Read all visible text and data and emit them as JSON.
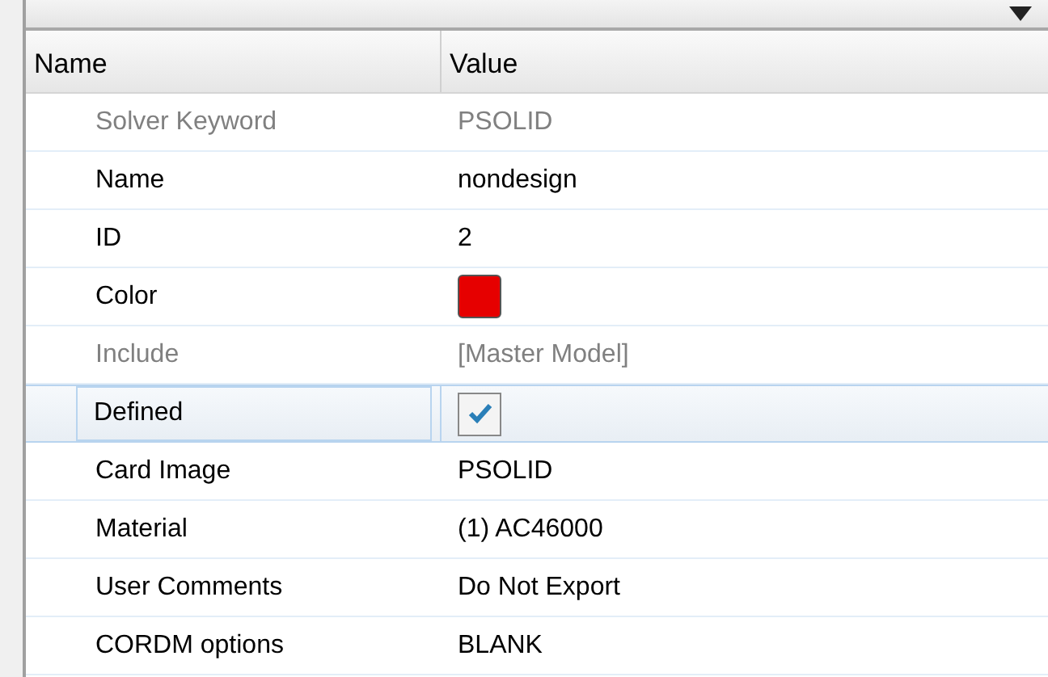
{
  "columns": [
    "Name",
    "Value"
  ],
  "rows": [
    {
      "name": "Solver Keyword",
      "kind": "text",
      "value": "PSOLID",
      "disabled": true,
      "selected": false
    },
    {
      "name": "Name",
      "kind": "text",
      "value": "nondesign",
      "disabled": false,
      "selected": false
    },
    {
      "name": "ID",
      "kind": "text",
      "value": "2",
      "disabled": false,
      "selected": false
    },
    {
      "name": "Color",
      "kind": "color",
      "color": "#e60000",
      "disabled": false,
      "selected": false
    },
    {
      "name": "Include",
      "kind": "text",
      "value": "[Master Model]",
      "disabled": true,
      "selected": false
    },
    {
      "name": "Defined",
      "kind": "checkbox",
      "checked": true,
      "disabled": false,
      "selected": true
    },
    {
      "name": "Card Image",
      "kind": "text",
      "value": "PSOLID",
      "disabled": false,
      "selected": false
    },
    {
      "name": "Material",
      "kind": "text",
      "value": "(1) AC46000",
      "disabled": false,
      "selected": false
    },
    {
      "name": "User Comments",
      "kind": "text",
      "value": "Do Not Export",
      "disabled": false,
      "selected": false
    },
    {
      "name": "CORDM options",
      "kind": "text",
      "value": "BLANK",
      "disabled": false,
      "selected": false
    }
  ]
}
